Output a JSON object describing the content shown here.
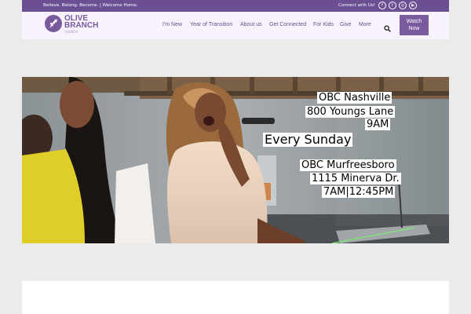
{
  "topbar": {
    "tagline": "Believe. Belong. Become. | Welcome Home.",
    "connect_label": "Connect with Us!",
    "social_icons": [
      "facebook-icon",
      "twitter-icon",
      "instagram-icon",
      "youtube-icon"
    ],
    "social_glyphs": [
      "f",
      "t",
      "◎",
      "▶"
    ]
  },
  "logo": {
    "line1": "OLIVE",
    "line2": "BRANCH",
    "line3": "CHURCH"
  },
  "nav": {
    "items": [
      "I'm New",
      "Year of Transition",
      "About us",
      "Get Connected",
      "For Kids",
      "Give",
      "More"
    ],
    "watch_line1": "Watch",
    "watch_line2": "Now"
  },
  "hero": {
    "loc1_name": "OBC Nashville",
    "loc1_address": "800 Youngs Lane",
    "loc1_time": "9AM",
    "schedule": "Every Sunday",
    "loc2_name": "OBC Murfreesboro",
    "loc2_address": "1115 Minerva Dr.",
    "loc2_time": "7AM|12:45PM"
  },
  "colors": {
    "brand": "#6c4e93",
    "accent": "#7a5a9f",
    "header_bg": "#f7f2fb",
    "page_bg": "#ebebeb"
  }
}
